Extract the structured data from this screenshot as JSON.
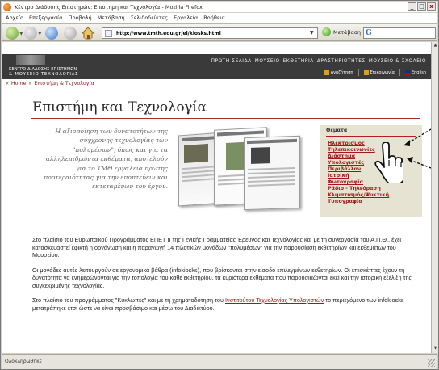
{
  "window": {
    "title": "Κέντρο Διάδοσης Επιστημών: Επιστήμη και Τεχνολογία - Mozilla Firefox",
    "controls": [
      "_",
      "□",
      "x"
    ]
  },
  "menu": [
    "Αρχείο",
    "Επεξεργασία",
    "Προβολή",
    "Μετάβαση",
    "Σελιδοδείκτες",
    "Εργαλεία",
    "Βοήθεια"
  ],
  "toolbar": {
    "url": "http://www.tmth.edu.gr/el/kiosks.html",
    "go_label": "Μετάβαση",
    "search_placeholder": ""
  },
  "site": {
    "logo_line1": "ΚΕΝΤΡΟ ΔΙΑΔΟΣΗΣ ΕΠΙΣΤΗΜΩΝ",
    "logo_line2": "& ΜΟΥΣΕΙΟ ΤΕΧΝΟΛΟΓΙΑΣ",
    "topnav": [
      "ΠΡΩΤΗ ΣΕΛΙΔΑ",
      "ΜΟΥΣΕΙΟ",
      "ΕΚΘΕΤΗΡΙΑ",
      "ΔΡΑΣΤΗΡΙΟΤΗΤΕΣ",
      "ΜΟΥΣΕΙΟ & ΣΧΟΛΕΙΟ"
    ],
    "util": [
      "Αναζήτηση",
      "Επικοινωνία",
      "English"
    ]
  },
  "breadcrumb": [
    "Home",
    "Επιστήμη & Τεχνολογία"
  ],
  "page": {
    "title": "Επιστήμη και Τεχνολογία",
    "quote": "Η αξιοποίηση των δυνατοτήτων της σύγχρονης τεχνολογίας των \"πολυμέσων\", όπως και για τα αλληλεπιδρώντα εκθέματα, αποτελούν για το ΤΜΘ εργαλεία πρώτης προτεραιότητας για την εποπτεύειν και εκτεταμένων του έργου.",
    "paragraph1": "Στο πλαίσιο του Ευρωπαϊκού Προγράμματος ΕΠΕΤ ΙΙ της Γενικής Γραμματείας Έρευνας και Τεχνολογίας και με τη συνεργασία του Α.Π.Θ., έχει κατασκευαστεί εφικτή η οργάνωση και η παραγωγή 14 πιλοτικών μονάδων \"πολυμέσων\" για την παρουσίαση εκθετηρίων και εκθεμάτων του Μουσείου.",
    "paragraph2": "Οι μονάδες αυτές λειτουργούν σε εργονομικά βάθρα (infokiosks), που βρίσκονται στην είσοδο επιλεγμένων εκθετηρίων. Οι επισκέπτες έχουν τη δυνατότητα να ενημερώνονται για την τοπολογία του κάθε εκθετηρίου, τα κυριότερα εκθέματα που παρουσιάζονται εκεί και την ιστορική εξέλιξη της συγκεκριμένης τεχνολογίας.",
    "paragraph3_before": "Στο πλαίσιο του προγράμματος \"Κύκλωπες\" και με τη χρηματοδότηση του ",
    "paragraph3_link": "Ινστιτούτου Τεχνολογίας Υπολογιστών",
    "paragraph3_after": " το περιεχόμενο των infokiosks μετατράπηκε έτσι ώστε να είναι προσβάσιμο και μέσω του Διαδικτύου."
  },
  "topics": {
    "heading": "Θέματα",
    "items": [
      "Ηλεκτρισμός",
      "Τηλεπικοινωνίες",
      "Διάστημα",
      "Υπολογιστές",
      "Περιβάλλον",
      "Ιατρική",
      "Φωτογραφία",
      "Ράδιο - Τηλεόραση",
      "Κλιματισμός/Ψυκτική",
      "Τυπογραφία"
    ]
  },
  "status": {
    "text": "Ολοκληρώθηκε"
  },
  "colors": {
    "accent": "#a01818",
    "header_bg": "#3a3a3a",
    "topics_bg": "#e7e3d3"
  }
}
